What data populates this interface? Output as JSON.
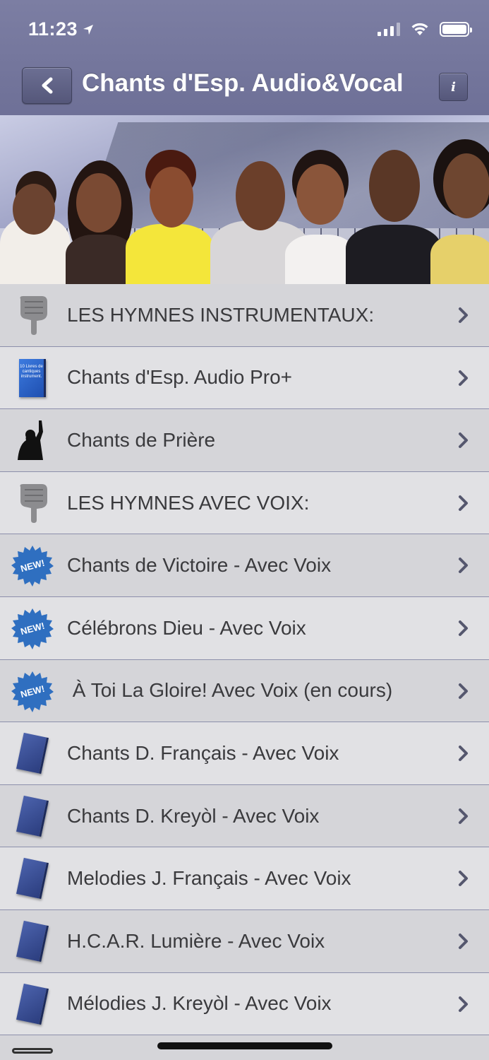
{
  "status": {
    "time": "11:23"
  },
  "nav": {
    "title": "Chants d'Esp. Audio&Vocal",
    "info_label": "i"
  },
  "list": [
    {
      "label": "LES HYMNES INSTRUMENTAUX:",
      "icon": "pointing-hand-icon"
    },
    {
      "label": "Chants d'Esp. Audio Pro+",
      "icon": "book-icon",
      "book_text": "10 Livres de cantiques instrument."
    },
    {
      "label": "Chants de Prière",
      "icon": "praying-person-icon"
    },
    {
      "label": "LES HYMNES AVEC VOIX:",
      "icon": "pointing-hand-icon"
    },
    {
      "label": "Chants de Victoire - Avec Voix",
      "icon": "new-badge-icon",
      "badge": "NEW!"
    },
    {
      "label": "Célébrons Dieu - Avec Voix",
      "icon": "new-badge-icon",
      "badge": "NEW!"
    },
    {
      "label": " À Toi La Gloire! Avec Voix (en cours)",
      "icon": "new-badge-icon",
      "badge": "NEW!"
    },
    {
      "label": "Chants D. Français - Avec Voix",
      "icon": "book-icon"
    },
    {
      "label": "Chants D. Kreyòl - Avec Voix",
      "icon": "book-icon"
    },
    {
      "label": "Melodies J. Français - Avec Voix",
      "icon": "book-icon"
    },
    {
      "label": "H.C.A.R. Lumière - Avec Voix",
      "icon": "book-icon"
    },
    {
      "label": "Mélodies J. Kreyòl - Avec Voix",
      "icon": "book-icon"
    }
  ],
  "colors": {
    "nav_bar": "#7c7ea3",
    "row_light": "#e1e1e4",
    "row_dark": "#d5d5d9",
    "badge_blue": "#2f6fc0"
  }
}
